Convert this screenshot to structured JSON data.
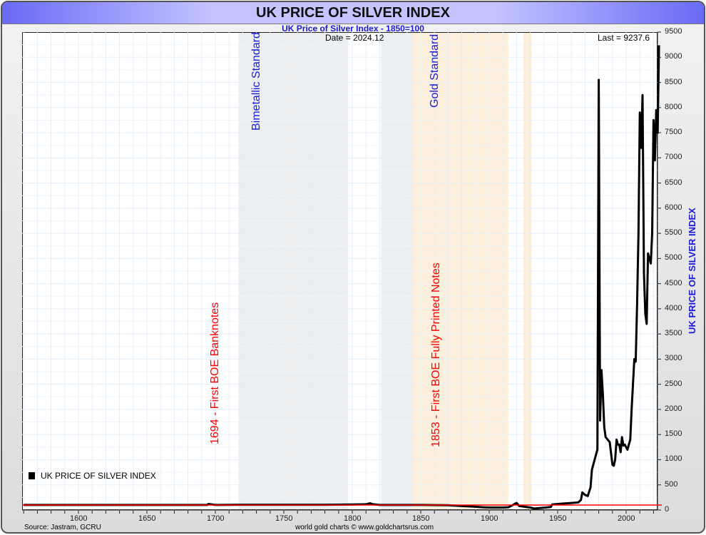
{
  "header": {
    "title": "UK PRICE OF SILVER INDEX",
    "subtitle": "UK Price of Silver Index - 1850=100"
  },
  "info": {
    "date": "Date = 2024.12",
    "last": "Last = 9237.6"
  },
  "footer": {
    "source": "Source: Jastram, GCRU",
    "credit": "world gold charts © www.goldchartsrus.com"
  },
  "annotations": {
    "banknotes": "1694 - First BOE Banknotes",
    "bimetallic": "Bimetallic Standard",
    "gold": "Gold Standard",
    "printed": "1853 - First BOE Fully Printed Notes"
  },
  "colors": {
    "line": "#000000",
    "baseline": "#ff0000",
    "gray_band": "#eceef0",
    "tan_band": "#fcf0dc",
    "axis_label": "#1a1ad8"
  },
  "chart_data": {
    "type": "line",
    "title": "UK PRICE OF SILVER INDEX",
    "ylabel": "UK PRICE OF SILVER INDEX",
    "xlim": [
      1559,
      2024.5
    ],
    "ylim": [
      0,
      9500
    ],
    "x_ticks": [
      1600,
      1650,
      1700,
      1750,
      1800,
      1850,
      1900,
      1950,
      2000
    ],
    "y_ticks": [
      0,
      500,
      1000,
      1500,
      2000,
      2500,
      3000,
      3500,
      4000,
      4500,
      5000,
      5500,
      6000,
      6500,
      7000,
      7500,
      8000,
      8500,
      9000,
      9500
    ],
    "grid": true,
    "legend": {
      "label": "UK PRICE OF SILVER INDEX",
      "placement": "bottom-left"
    },
    "baseline": 100,
    "bands": [
      {
        "from": 1717,
        "to": 1797,
        "kind": "gray"
      },
      {
        "from": 1821,
        "to": 1844,
        "kind": "gray"
      },
      {
        "from": 1844,
        "to": 1914,
        "kind": "tan"
      },
      {
        "from": 1925,
        "to": 1931,
        "kind": "tan"
      }
    ],
    "series": [
      {
        "name": "UK PRICE OF SILVER INDEX",
        "x": [
          1560,
          1600,
          1650,
          1694,
          1695,
          1700,
          1720,
          1750,
          1780,
          1800,
          1810,
          1813,
          1815,
          1820,
          1830,
          1850,
          1870,
          1880,
          1890,
          1895,
          1900,
          1910,
          1914,
          1918,
          1920,
          1922,
          1930,
          1933,
          1940,
          1945,
          1946,
          1950,
          1955,
          1960,
          1965,
          1967,
          1968,
          1970,
          1972,
          1974,
          1975,
          1977,
          1979,
          1980,
          1981,
          1982,
          1983,
          1984,
          1985,
          1988,
          1990,
          1991,
          1992,
          1993,
          1994,
          1995,
          1996,
          1997,
          1998,
          1999,
          2000,
          2001,
          2002,
          2003,
          2004,
          2005,
          2006,
          2007,
          2008,
          2009,
          2010,
          2011,
          2012,
          2013,
          2014,
          2015,
          2016,
          2017,
          2018,
          2019,
          2020,
          2021,
          2022,
          2023,
          2024
        ],
        "y": [
          100,
          100,
          100,
          100,
          120,
          100,
          105,
          105,
          105,
          110,
          115,
          135,
          115,
          100,
          100,
          100,
          95,
          80,
          65,
          55,
          50,
          50,
          55,
          110,
          140,
          80,
          50,
          30,
          45,
          60,
          110,
          120,
          130,
          140,
          150,
          200,
          350,
          300,
          280,
          450,
          800,
          1000,
          1200,
          8550,
          1780,
          2780,
          2300,
          1650,
          1450,
          1350,
          900,
          880,
          1000,
          1400,
          1300,
          1300,
          1150,
          1450,
          1280,
          1300,
          1250,
          1200,
          1300,
          1400,
          2000,
          2500,
          3000,
          2950,
          4100,
          5500,
          7900,
          7200,
          8250,
          4700,
          3900,
          3700,
          5100,
          5000,
          4900,
          5500,
          7750,
          6950,
          7950,
          7500,
          9237.6
        ]
      }
    ]
  }
}
